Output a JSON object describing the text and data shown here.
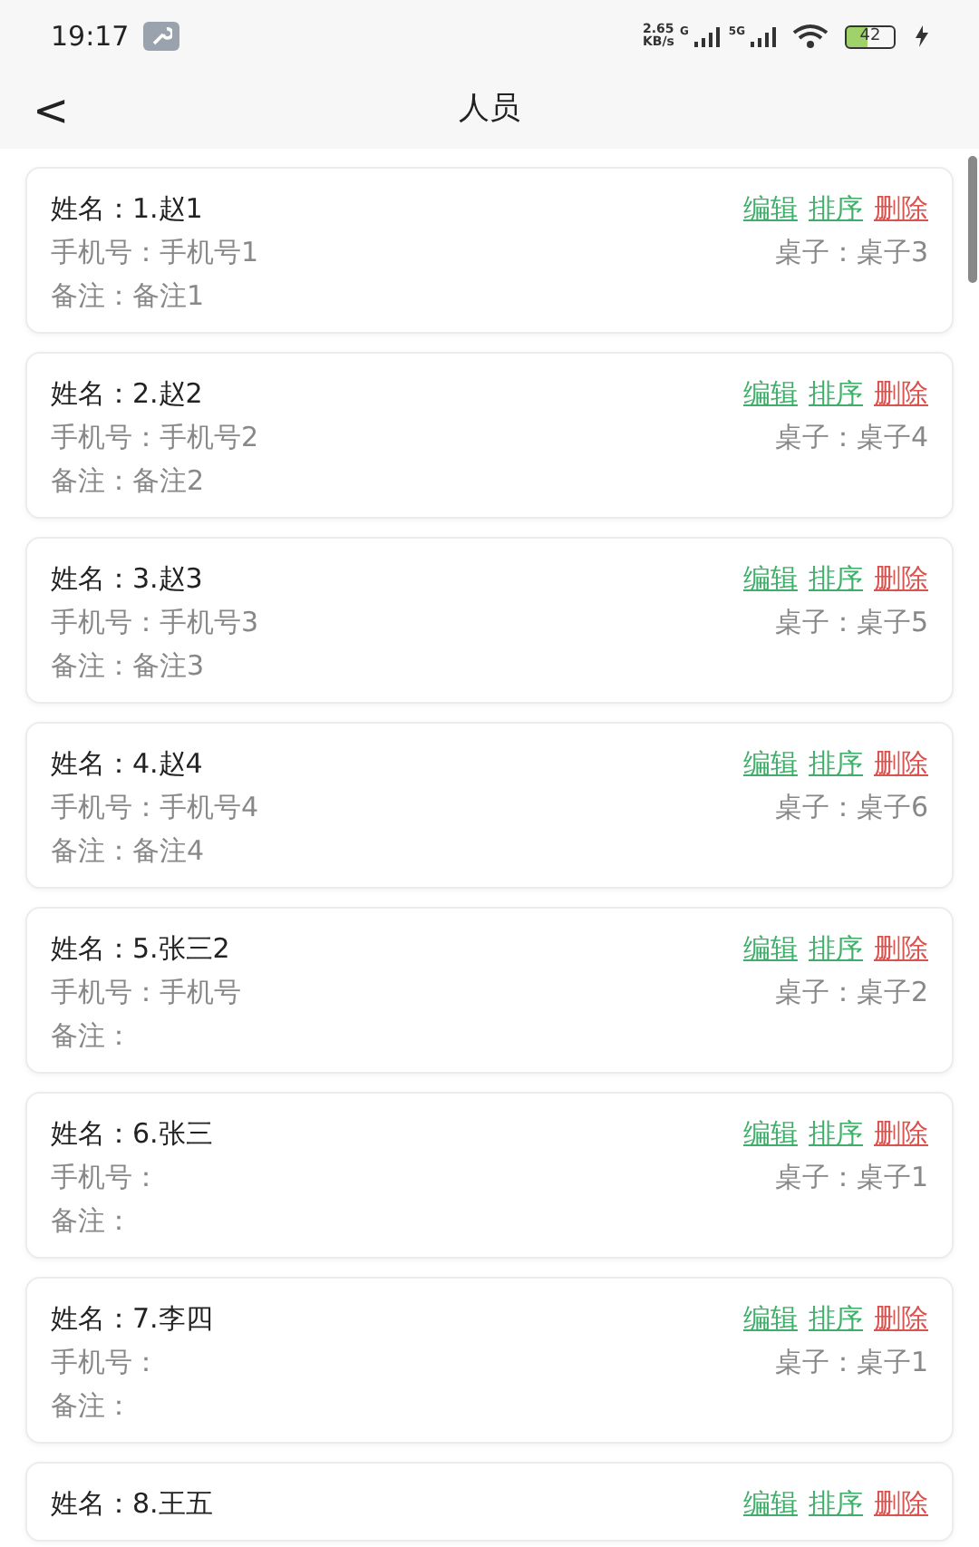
{
  "status_bar": {
    "time": "19:17",
    "speed_value": "2.65",
    "speed_unit": "KB/s",
    "sim1_label": "G",
    "sim2_label": "5G",
    "battery": "42"
  },
  "header": {
    "back": "<",
    "title": "人员"
  },
  "people": [
    {
      "name_label": "姓名：",
      "name": "1.赵1",
      "phone_label": "手机号：",
      "phone": "手机号1",
      "note_label": "备注：",
      "note": "备注1",
      "table_label": "桌子：",
      "table": "桌子3",
      "actions": [
        "编辑",
        "排序",
        "删除"
      ]
    },
    {
      "name_label": "姓名：",
      "name": "2.赵2",
      "phone_label": "手机号：",
      "phone": "手机号2",
      "note_label": "备注：",
      "note": "备注2",
      "table_label": "桌子：",
      "table": "桌子4",
      "actions": [
        "编辑",
        "排序",
        "删除"
      ]
    },
    {
      "name_label": "姓名：",
      "name": "3.赵3",
      "phone_label": "手机号：",
      "phone": "手机号3",
      "note_label": "备注：",
      "note": "备注3",
      "table_label": "桌子：",
      "table": "桌子5",
      "actions": [
        "编辑",
        "排序",
        "删除"
      ]
    },
    {
      "name_label": "姓名：",
      "name": "4.赵4",
      "phone_label": "手机号：",
      "phone": "手机号4",
      "note_label": "备注：",
      "note": "备注4",
      "table_label": "桌子：",
      "table": "桌子6",
      "actions": [
        "编辑",
        "排序",
        "删除"
      ]
    },
    {
      "name_label": "姓名：",
      "name": "5.张三2",
      "phone_label": "手机号：",
      "phone": "手机号",
      "note_label": "备注：",
      "table_label": "桌子：",
      "table": "桌子2",
      "actions": [
        "编辑",
        "排序",
        "删除"
      ]
    },
    {
      "name_label": "姓名：",
      "name": "6.张三",
      "phone_label": "手机号：",
      "note_label": "备注：",
      "table_label": "桌子：",
      "table": "桌子1",
      "actions": [
        "编辑",
        "排序",
        "删除"
      ]
    },
    {
      "name_label": "姓名：",
      "name": "7.李四",
      "phone_label": "手机号：",
      "note_label": "备注：",
      "table_label": "桌子：",
      "table": "桌子1",
      "actions": [
        "编辑",
        "排序",
        "删除"
      ]
    },
    {
      "name_label": "姓名：",
      "name": "8.王五",
      "actions": [
        "编辑",
        "排序",
        "删除"
      ]
    }
  ]
}
